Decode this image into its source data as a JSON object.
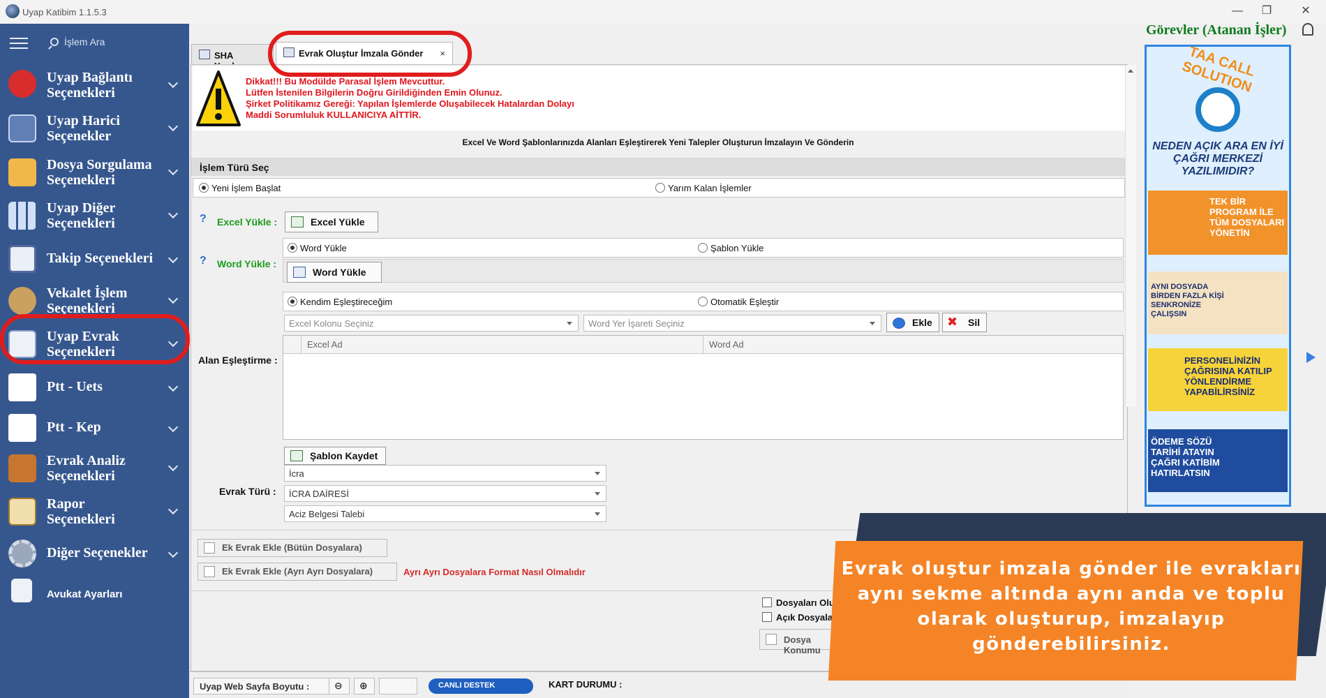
{
  "window": {
    "title": "Uyap Katibim 1.1.5.3",
    "controls": [
      "—",
      "❐",
      "✕"
    ]
  },
  "sidebar": {
    "search_placeholder": "İşlem Ara",
    "items": [
      {
        "label_line1": "Uyap Bağlantı",
        "label_line2": "Seçenekleri",
        "icon": "uyap-link-icon"
      },
      {
        "label_line1": "Uyap Harici",
        "label_line2": "Seçenekler",
        "icon": "help-book-icon"
      },
      {
        "label_line1": "Dosya Sorgulama",
        "label_line2": "Seçenekleri",
        "icon": "folder-icon"
      },
      {
        "label_line1": "Uyap Diğer",
        "label_line2": "Seçenekleri",
        "icon": "grid-icon"
      },
      {
        "label_line1": "Takip Seçenekleri",
        "label_line2": "",
        "icon": "tracking-icon"
      },
      {
        "label_line1": "Vekalet İşlem",
        "label_line2": "Seçenekleri",
        "icon": "lawyer-icon"
      },
      {
        "label_line1": "Uyap Evrak",
        "label_line2": "Seçenekleri",
        "icon": "document-icon"
      },
      {
        "label_line1": "Ptt - Uets",
        "label_line2": "",
        "icon": "ptt-icon"
      },
      {
        "label_line1": "Ptt - Kep",
        "label_line2": "",
        "icon": "ptt-icon"
      },
      {
        "label_line1": "Evrak Analiz",
        "label_line2": "Seçenekleri",
        "icon": "briefcase-icon"
      },
      {
        "label_line1": "Rapor",
        "label_line2": "Seçenekleri",
        "icon": "clipboard-icon"
      },
      {
        "label_line1": "Diğer Seçenekler",
        "label_line2": "",
        "icon": "gear-icon"
      },
      {
        "label_line1": "Avukat Ayarları",
        "label_line2": "",
        "icon": "user-settings-icon"
      }
    ]
  },
  "tabs": [
    {
      "label": "SHA Yazılım"
    },
    {
      "label": "Evrak Oluştur İmzala Gönder",
      "close": "×"
    }
  ],
  "warning": {
    "line1": "Dikkat!!! Bu Modülde Parasal İşlem Mevcuttur.",
    "line2": "Lütfen İstenilen Bilgilerin Doğru Girildiğinden Emin Olunuz.",
    "line3": "Şirket Politikamız Gereği: Yapılan İşlemlerde Oluşabilecek Hatalardan Dolayı",
    "line4": "Maddi Sorumluluk KULLANICIYA AİTTİR."
  },
  "form": {
    "header": "Excel Ve Word Şablonlarınızda Alanları Eşleştirerek Yeni Talepler Oluşturun İmzalayın Ve Gönderin",
    "section_title": "İşlem Türü Seç",
    "radio_new": "Yeni İşlem Başlat",
    "radio_unfinished": "Yarım Kalan İşlemler",
    "help_q": "?",
    "excel_label": "Excel Yükle :",
    "excel_button": "Excel Yükle",
    "word_label": "Word Yükle :",
    "radio_word": "Word Yükle",
    "radio_template": "Şablon Yükle",
    "word_button": "Word Yükle",
    "radio_manual": "Kendim Eşleştireceğim",
    "radio_auto": "Otomatik Eşleştir",
    "excel_col_placeholder": "Excel Kolonu Seçiniz",
    "word_mark_placeholder": "Word Yer İşareti Seçiniz",
    "add_button": "Ekle",
    "delete_button": "Sil",
    "mapping_label": "Alan Eşleştirme :",
    "grid_col1": "Excel Ad",
    "grid_col2": "Word Ad",
    "save_template": "Şablon Kaydet",
    "doc_type_label": "Evrak Türü :",
    "doc_type1": "İcra",
    "doc_type2": "İCRA DAİRESİ",
    "doc_type3": "Aciz Belgesi Talebi",
    "ek_all": "Ek Evrak Ekle (Bütün Dosyalara)",
    "ek_each": "Ek Evrak Ekle (Ayrı Ayrı Dosyalara)",
    "format_link": "Ayrı Ayrı Dosyalara Format Nasıl Olmalıdır",
    "chk_dosyalari": "Dosyaları Olu",
    "chk_acik": "Açık Dosyaları",
    "dosya_konumu": "Dosya Konumu"
  },
  "statusbar": {
    "page_size_label": "Uyap Web Sayfa Boyutu :",
    "live_support": "CANLI DESTEK",
    "card_status": "KART DURUMU :"
  },
  "right_panel": {
    "title": "Görevler (Atanan İşler)",
    "ad": {
      "brand": "TAA CALL SOLUTION",
      "question": "NEDEN AÇIK ARA EN İYİ ÇAĞRI MERKEZİ YAZILIMIDIR?",
      "card1": "TEK BİR PROGRAM İLE TÜM DOSYALARI YÖNETİN",
      "card2": "AYNI DOSYADA BİRDEN FAZLA KİŞİ SENKRONİZE ÇALIŞSIN",
      "card3": "PERSONELİNİZİN ÇAĞRISINA KATILIP YÖNLENDİRME YAPABİLİRSİNİZ",
      "card4": "ÖDEME SÖZÜ TARİHİ ATAYIN ÇAĞRI KATİBİM HATIRLATSIN"
    }
  },
  "promo": {
    "text": "Evrak oluştur imzala gönder ile evrakları aynı sekme altında aynı anda ve toplu olarak oluşturup, imzalayıp gönderebilirsiniz."
  },
  "colors": {
    "sidebar_bg": "#36578e",
    "warning_red": "#e0161d",
    "highlight_ring": "#e01d1d",
    "green_label": "#1b9c1b",
    "promo_orange": "#f58426",
    "promo_dark": "#2b3a54"
  }
}
